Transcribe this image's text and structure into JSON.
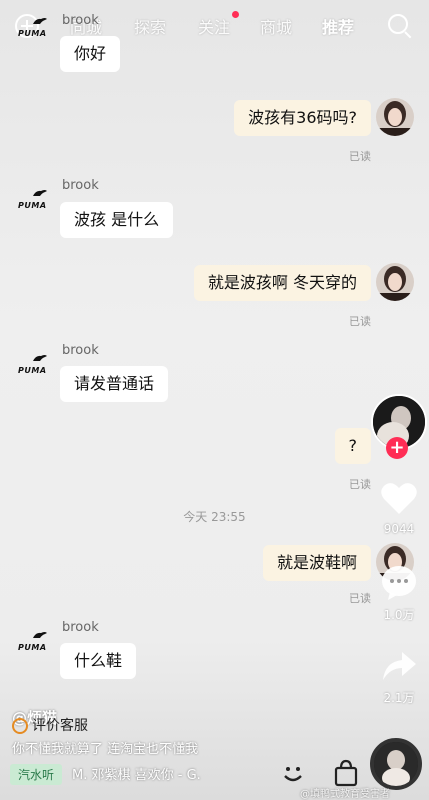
{
  "nav": {
    "tabs": [
      "同城",
      "探索",
      "关注",
      "商城",
      "推荐"
    ],
    "active": "推荐"
  },
  "chat": {
    "sender_name": "brook",
    "brand_word": "PUMA",
    "read_label": "已读",
    "messages": [
      {
        "from": "them",
        "text": "你好"
      },
      {
        "from": "me",
        "text": "波孩有36码吗?"
      },
      {
        "from": "them",
        "text": "波孩 是什么"
      },
      {
        "from": "me",
        "text": "就是波孩啊 冬天穿的"
      },
      {
        "from": "them",
        "text": "请发普通话"
      },
      {
        "from": "me",
        "text": "?"
      },
      {
        "from": "me",
        "text": "就是波鞋啊"
      },
      {
        "from": "them",
        "text": "什么鞋"
      }
    ],
    "timestamp": "今天 23:55"
  },
  "sidebar": {
    "likes": "9044",
    "comments": "1.0万",
    "shares": "2.1万",
    "follow_symbol": "+"
  },
  "overlay": {
    "handle": "@烦猫",
    "review_label": "评价客服",
    "caption": "你不懂我就算了 连淘宝也不懂我",
    "music_tag": "汽水听",
    "music_text": "M. 邓紫棋   喜欢你 - G.",
    "watermark": "@填鸭式教育受害者"
  },
  "colors": {
    "accent": "#ff2d55",
    "bubble_out": "#fbf3e2",
    "bubble_in": "#ffffff"
  }
}
